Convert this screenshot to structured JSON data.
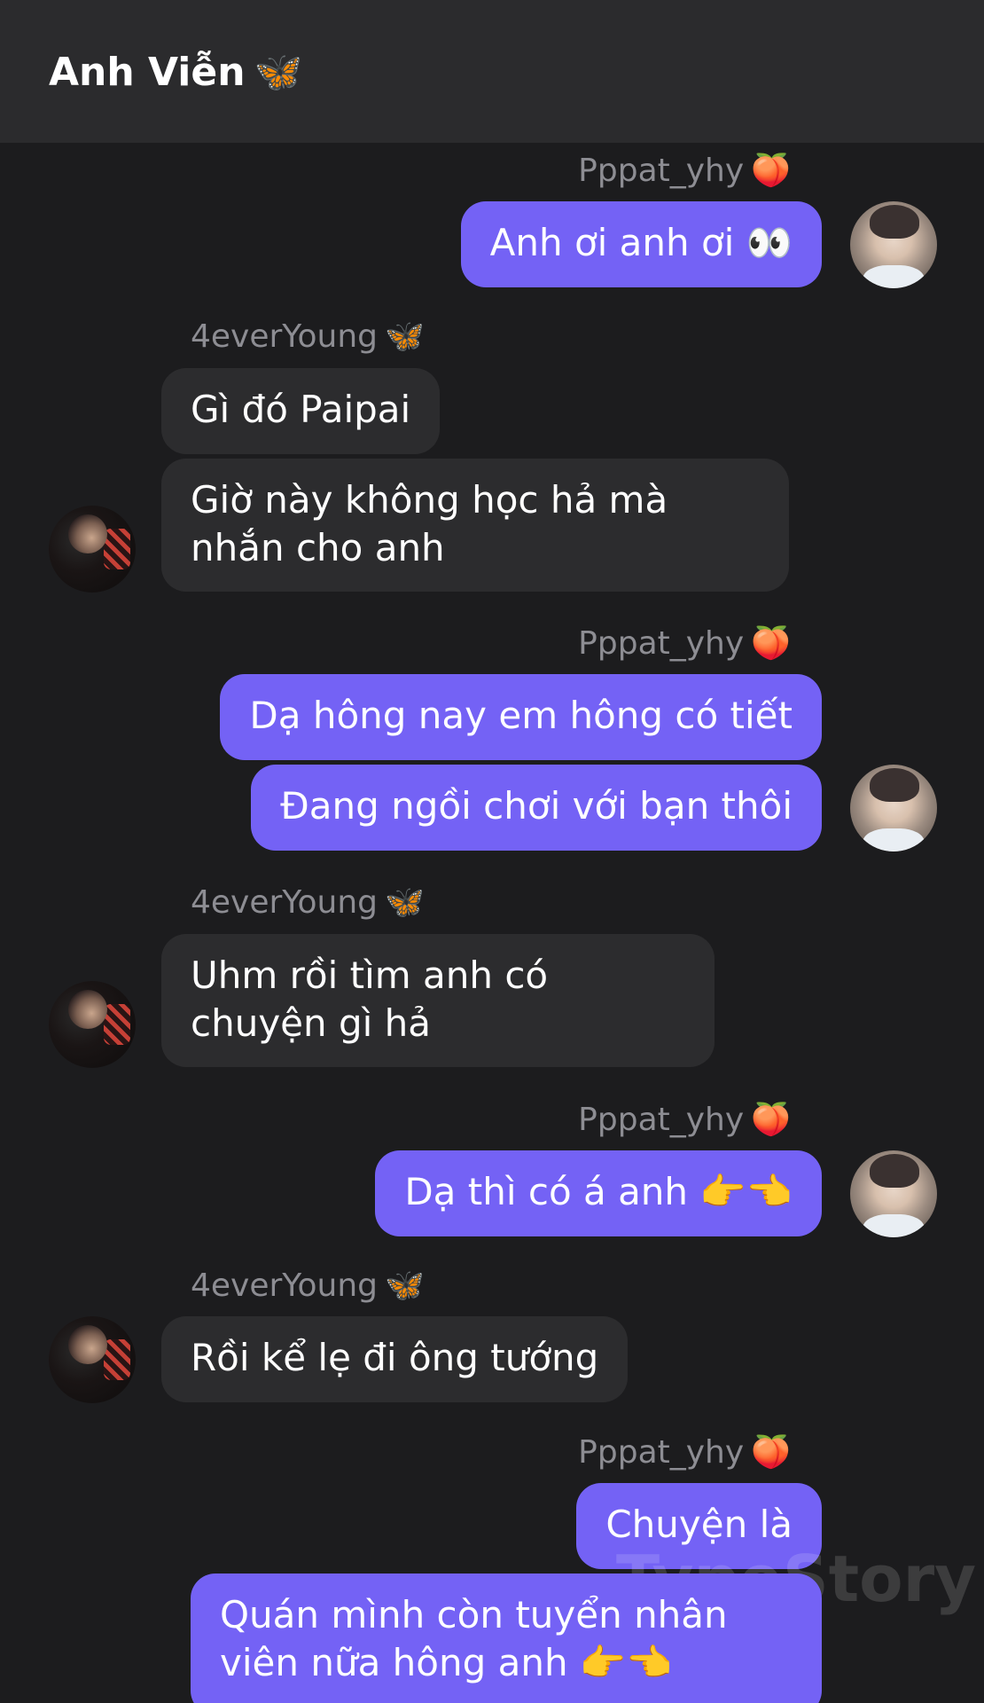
{
  "header": {
    "title": "Anh Viễn",
    "title_emoji": "🦋"
  },
  "participants": {
    "me": {
      "name": "Pppat_yhy",
      "emoji": "🍑"
    },
    "them": {
      "name": "4everYoung",
      "emoji": "🦋"
    }
  },
  "messages": [
    {
      "from": "me",
      "text": "Anh ơi anh ơi 👀"
    },
    {
      "from": "them",
      "text": "Gì đó Paipai"
    },
    {
      "from": "them",
      "text": "Giờ này không học hả mà nhắn cho anh"
    },
    {
      "from": "me",
      "text": "Dạ hông nay em hông có tiết"
    },
    {
      "from": "me",
      "text": "Đang ngồi chơi với bạn thôi"
    },
    {
      "from": "them",
      "text": "Uhm rồi tìm anh có chuyện gì hả"
    },
    {
      "from": "me",
      "text": "Dạ thì có á anh 👉👈"
    },
    {
      "from": "them",
      "text": "Rồi kể lẹ đi ông tướng"
    },
    {
      "from": "me",
      "text": "Chuyện là"
    },
    {
      "from": "me",
      "text": "Quán mình còn tuyển nhân viên nữa hông anh 👉👈"
    }
  ],
  "watermark": "TypeStory",
  "colors": {
    "background": "#1c1c1e",
    "header_background": "#2b2b2d",
    "my_bubble": "#7462f5",
    "their_bubble": "#2c2c2e",
    "sender_text": "#8d8d93"
  }
}
